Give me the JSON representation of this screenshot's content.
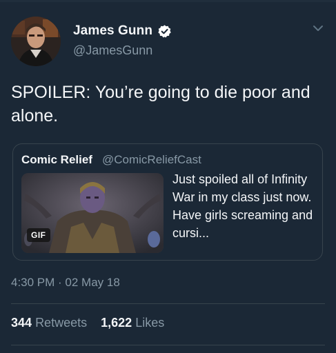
{
  "tweet": {
    "author_name": "James Gunn",
    "author_handle": "@JamesGunn",
    "verified_icon": "verified-badge-icon",
    "menu_icon": "chevron-down-icon",
    "text": "SPOILER: You’re going to die poor and alone.",
    "timestamp": "4:30 PM · 02 May 18",
    "retweets_count": "344",
    "retweets_label": "Retweets",
    "likes_count": "1,622",
    "likes_label": "Likes"
  },
  "quoted_tweet": {
    "author_name": "Comic Relief",
    "author_handle": "@ComicReliefCast",
    "media_badge": "GIF",
    "text": "Just spoiled all of Infinity War in my class just now. Have girls screaming and cursi..."
  },
  "colors": {
    "background": "#1b2836",
    "primary_text": "#f4f6f8",
    "secondary_text": "#8899a6",
    "border": "#38444d"
  }
}
